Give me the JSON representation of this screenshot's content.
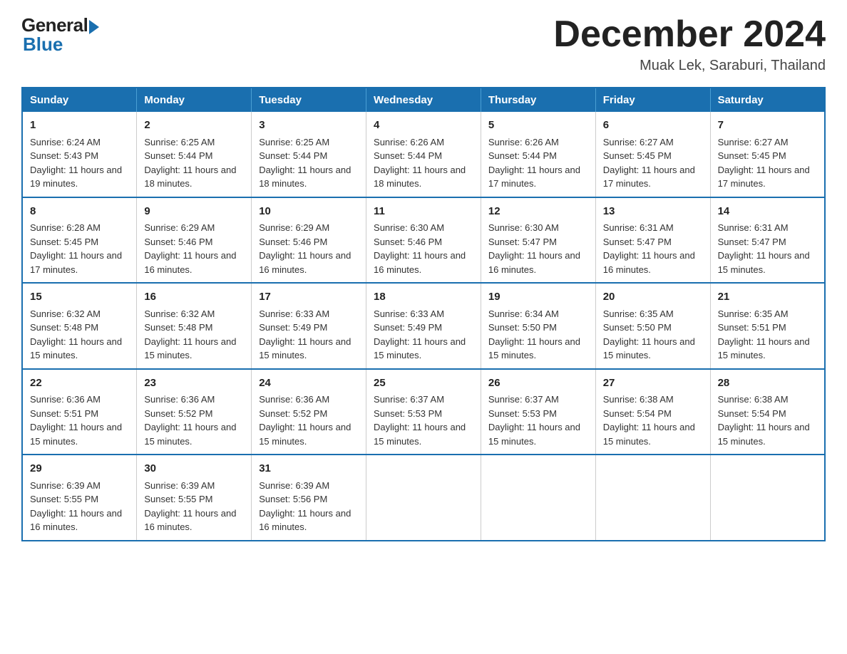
{
  "logo": {
    "general": "General",
    "blue": "Blue"
  },
  "header": {
    "month": "December 2024",
    "location": "Muak Lek, Saraburi, Thailand"
  },
  "days_of_week": [
    "Sunday",
    "Monday",
    "Tuesday",
    "Wednesday",
    "Thursday",
    "Friday",
    "Saturday"
  ],
  "weeks": [
    [
      {
        "day": "1",
        "sunrise": "6:24 AM",
        "sunset": "5:43 PM",
        "daylight": "11 hours and 19 minutes."
      },
      {
        "day": "2",
        "sunrise": "6:25 AM",
        "sunset": "5:44 PM",
        "daylight": "11 hours and 18 minutes."
      },
      {
        "day": "3",
        "sunrise": "6:25 AM",
        "sunset": "5:44 PM",
        "daylight": "11 hours and 18 minutes."
      },
      {
        "day": "4",
        "sunrise": "6:26 AM",
        "sunset": "5:44 PM",
        "daylight": "11 hours and 18 minutes."
      },
      {
        "day": "5",
        "sunrise": "6:26 AM",
        "sunset": "5:44 PM",
        "daylight": "11 hours and 17 minutes."
      },
      {
        "day": "6",
        "sunrise": "6:27 AM",
        "sunset": "5:45 PM",
        "daylight": "11 hours and 17 minutes."
      },
      {
        "day": "7",
        "sunrise": "6:27 AM",
        "sunset": "5:45 PM",
        "daylight": "11 hours and 17 minutes."
      }
    ],
    [
      {
        "day": "8",
        "sunrise": "6:28 AM",
        "sunset": "5:45 PM",
        "daylight": "11 hours and 17 minutes."
      },
      {
        "day": "9",
        "sunrise": "6:29 AM",
        "sunset": "5:46 PM",
        "daylight": "11 hours and 16 minutes."
      },
      {
        "day": "10",
        "sunrise": "6:29 AM",
        "sunset": "5:46 PM",
        "daylight": "11 hours and 16 minutes."
      },
      {
        "day": "11",
        "sunrise": "6:30 AM",
        "sunset": "5:46 PM",
        "daylight": "11 hours and 16 minutes."
      },
      {
        "day": "12",
        "sunrise": "6:30 AM",
        "sunset": "5:47 PM",
        "daylight": "11 hours and 16 minutes."
      },
      {
        "day": "13",
        "sunrise": "6:31 AM",
        "sunset": "5:47 PM",
        "daylight": "11 hours and 16 minutes."
      },
      {
        "day": "14",
        "sunrise": "6:31 AM",
        "sunset": "5:47 PM",
        "daylight": "11 hours and 15 minutes."
      }
    ],
    [
      {
        "day": "15",
        "sunrise": "6:32 AM",
        "sunset": "5:48 PM",
        "daylight": "11 hours and 15 minutes."
      },
      {
        "day": "16",
        "sunrise": "6:32 AM",
        "sunset": "5:48 PM",
        "daylight": "11 hours and 15 minutes."
      },
      {
        "day": "17",
        "sunrise": "6:33 AM",
        "sunset": "5:49 PM",
        "daylight": "11 hours and 15 minutes."
      },
      {
        "day": "18",
        "sunrise": "6:33 AM",
        "sunset": "5:49 PM",
        "daylight": "11 hours and 15 minutes."
      },
      {
        "day": "19",
        "sunrise": "6:34 AM",
        "sunset": "5:50 PM",
        "daylight": "11 hours and 15 minutes."
      },
      {
        "day": "20",
        "sunrise": "6:35 AM",
        "sunset": "5:50 PM",
        "daylight": "11 hours and 15 minutes."
      },
      {
        "day": "21",
        "sunrise": "6:35 AM",
        "sunset": "5:51 PM",
        "daylight": "11 hours and 15 minutes."
      }
    ],
    [
      {
        "day": "22",
        "sunrise": "6:36 AM",
        "sunset": "5:51 PM",
        "daylight": "11 hours and 15 minutes."
      },
      {
        "day": "23",
        "sunrise": "6:36 AM",
        "sunset": "5:52 PM",
        "daylight": "11 hours and 15 minutes."
      },
      {
        "day": "24",
        "sunrise": "6:36 AM",
        "sunset": "5:52 PM",
        "daylight": "11 hours and 15 minutes."
      },
      {
        "day": "25",
        "sunrise": "6:37 AM",
        "sunset": "5:53 PM",
        "daylight": "11 hours and 15 minutes."
      },
      {
        "day": "26",
        "sunrise": "6:37 AM",
        "sunset": "5:53 PM",
        "daylight": "11 hours and 15 minutes."
      },
      {
        "day": "27",
        "sunrise": "6:38 AM",
        "sunset": "5:54 PM",
        "daylight": "11 hours and 15 minutes."
      },
      {
        "day": "28",
        "sunrise": "6:38 AM",
        "sunset": "5:54 PM",
        "daylight": "11 hours and 15 minutes."
      }
    ],
    [
      {
        "day": "29",
        "sunrise": "6:39 AM",
        "sunset": "5:55 PM",
        "daylight": "11 hours and 16 minutes."
      },
      {
        "day": "30",
        "sunrise": "6:39 AM",
        "sunset": "5:55 PM",
        "daylight": "11 hours and 16 minutes."
      },
      {
        "day": "31",
        "sunrise": "6:39 AM",
        "sunset": "5:56 PM",
        "daylight": "11 hours and 16 minutes."
      },
      null,
      null,
      null,
      null
    ]
  ],
  "labels": {
    "sunrise": "Sunrise:",
    "sunset": "Sunset:",
    "daylight": "Daylight:"
  }
}
